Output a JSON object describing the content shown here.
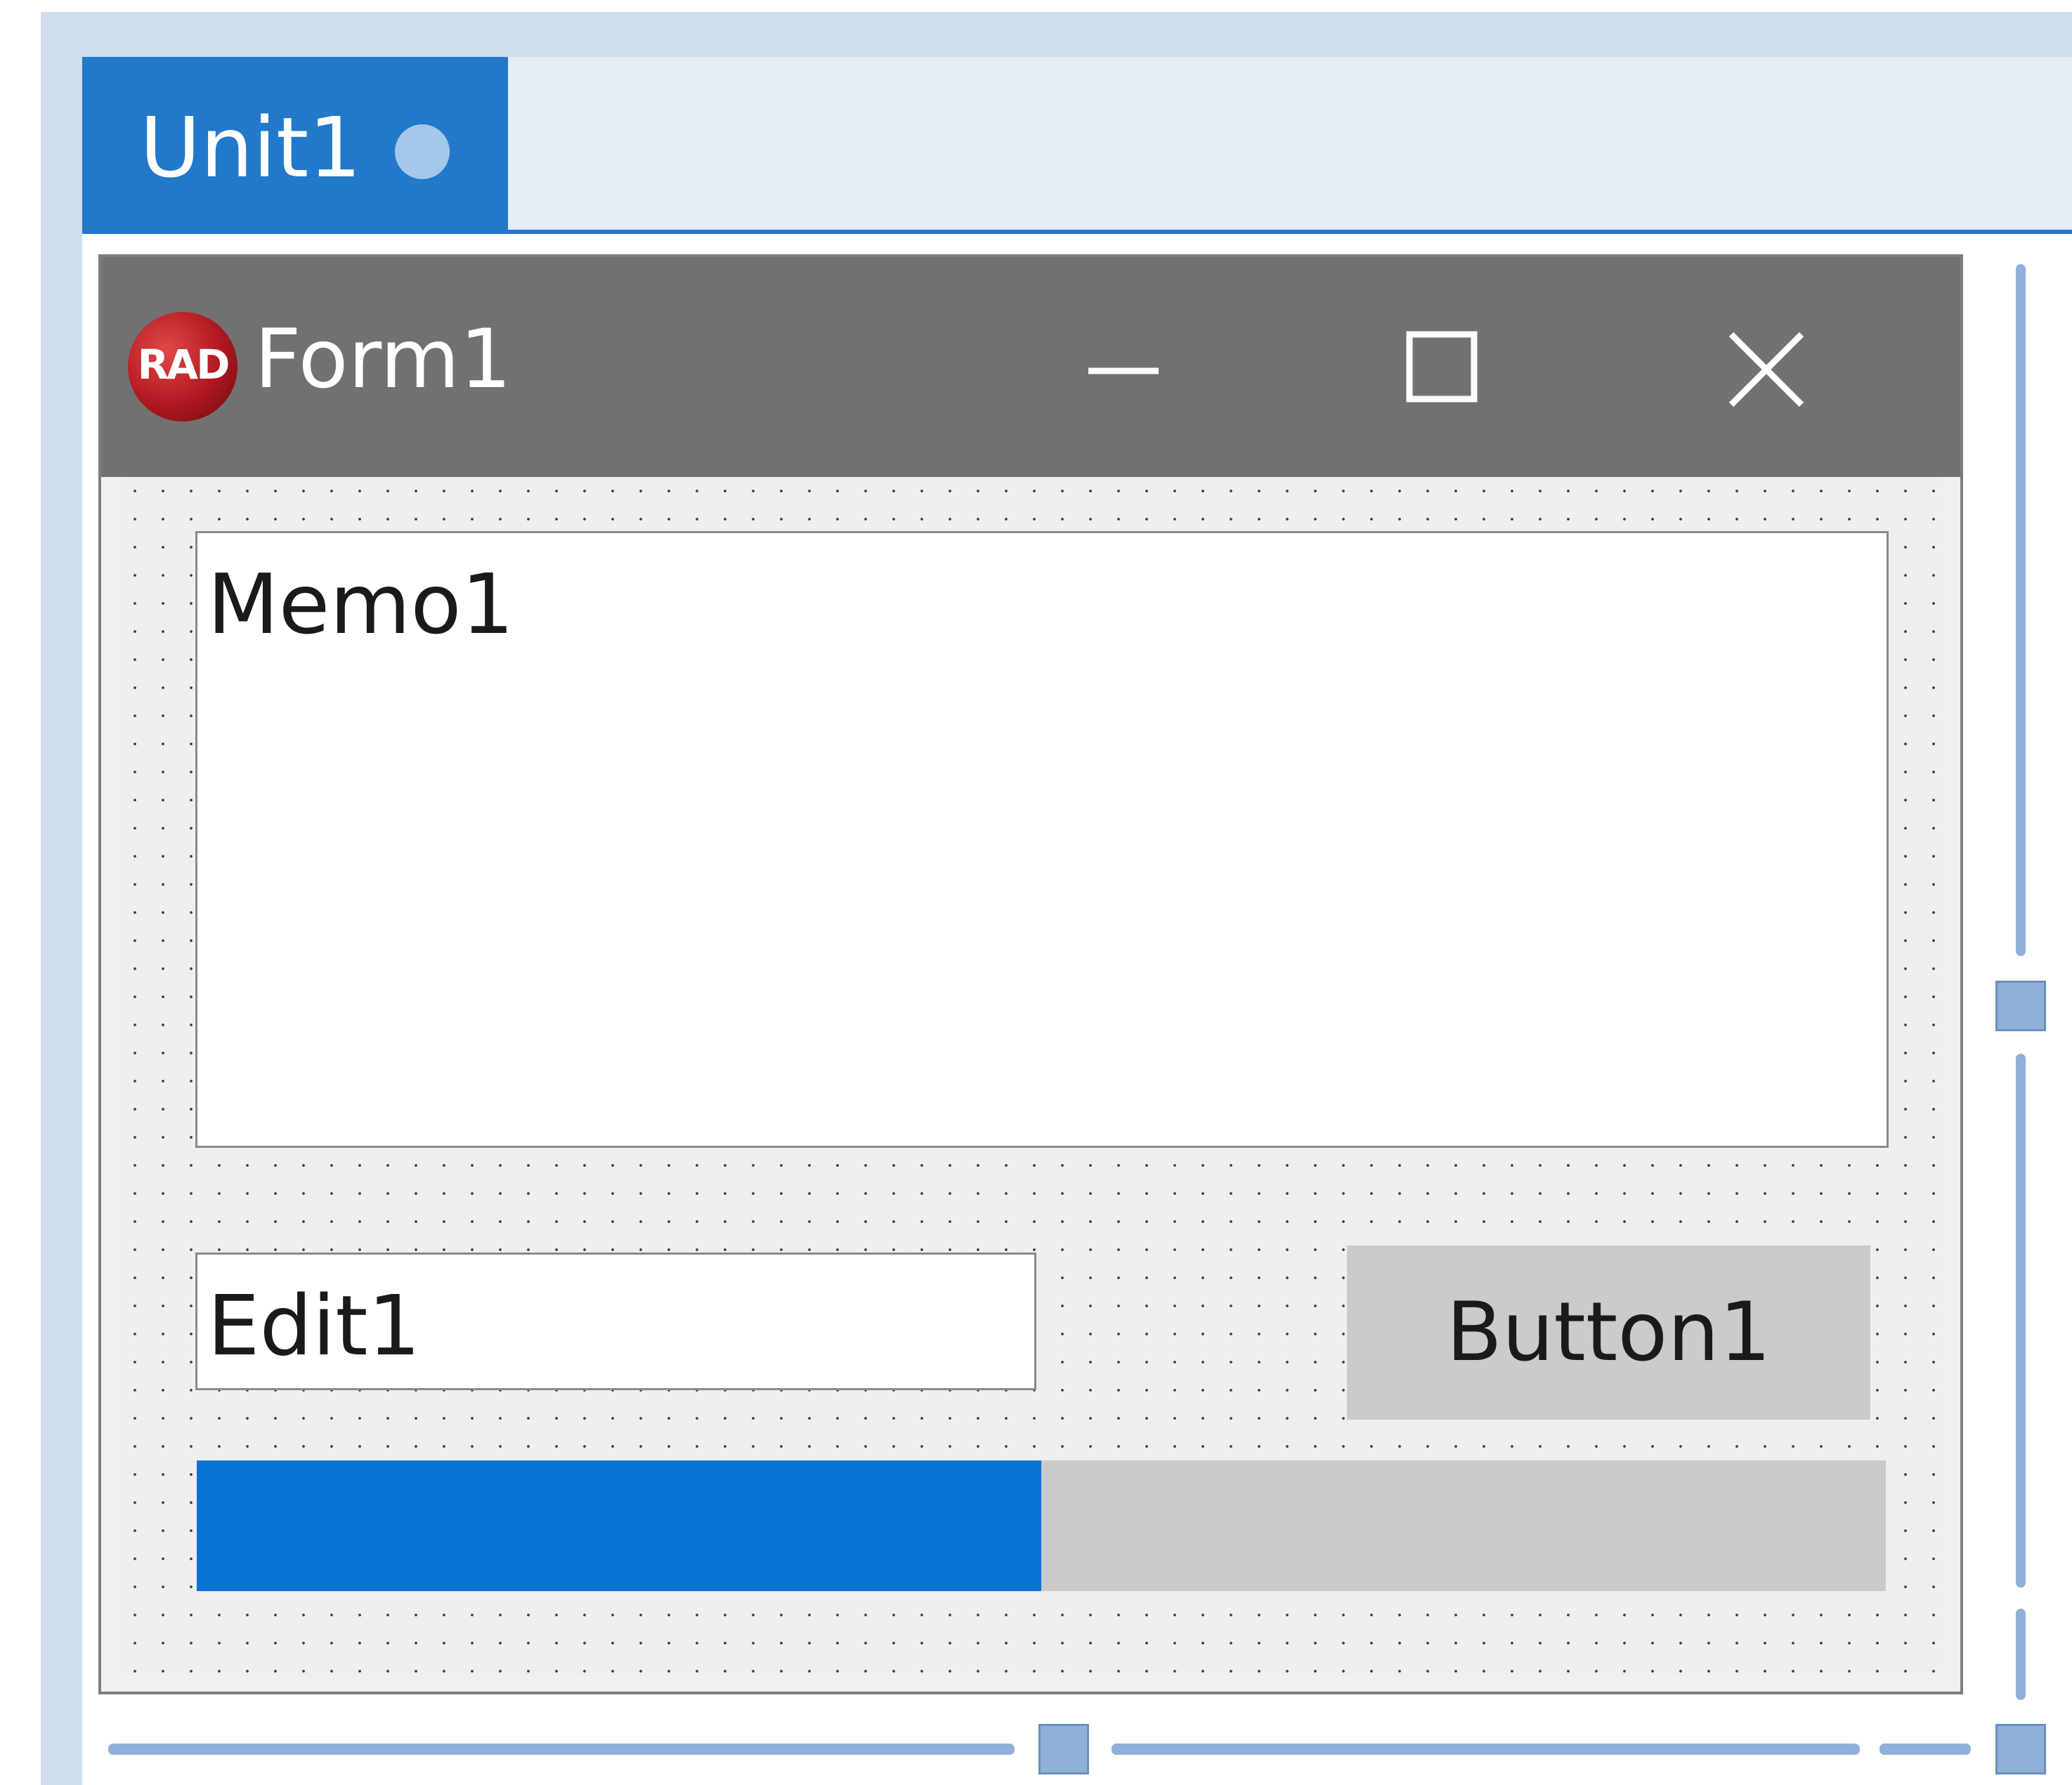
{
  "tab": {
    "label": "Unit1",
    "modified_dot": "modified-dot-icon"
  },
  "form": {
    "title": "Form1",
    "logo_text": "RAD",
    "controls": {
      "minimize": "minimize-icon",
      "maximize": "maximize-icon",
      "close": "close-icon"
    }
  },
  "memo": {
    "text": "Memo1"
  },
  "edit": {
    "value": "Edit1"
  },
  "button": {
    "label": "Button1"
  },
  "progress": {
    "value_percent": 50
  },
  "colors": {
    "accent": "#2278c9",
    "titlebar": "#717171",
    "progress_fill": "#0a73d6",
    "guide": "#8fb0d9"
  }
}
